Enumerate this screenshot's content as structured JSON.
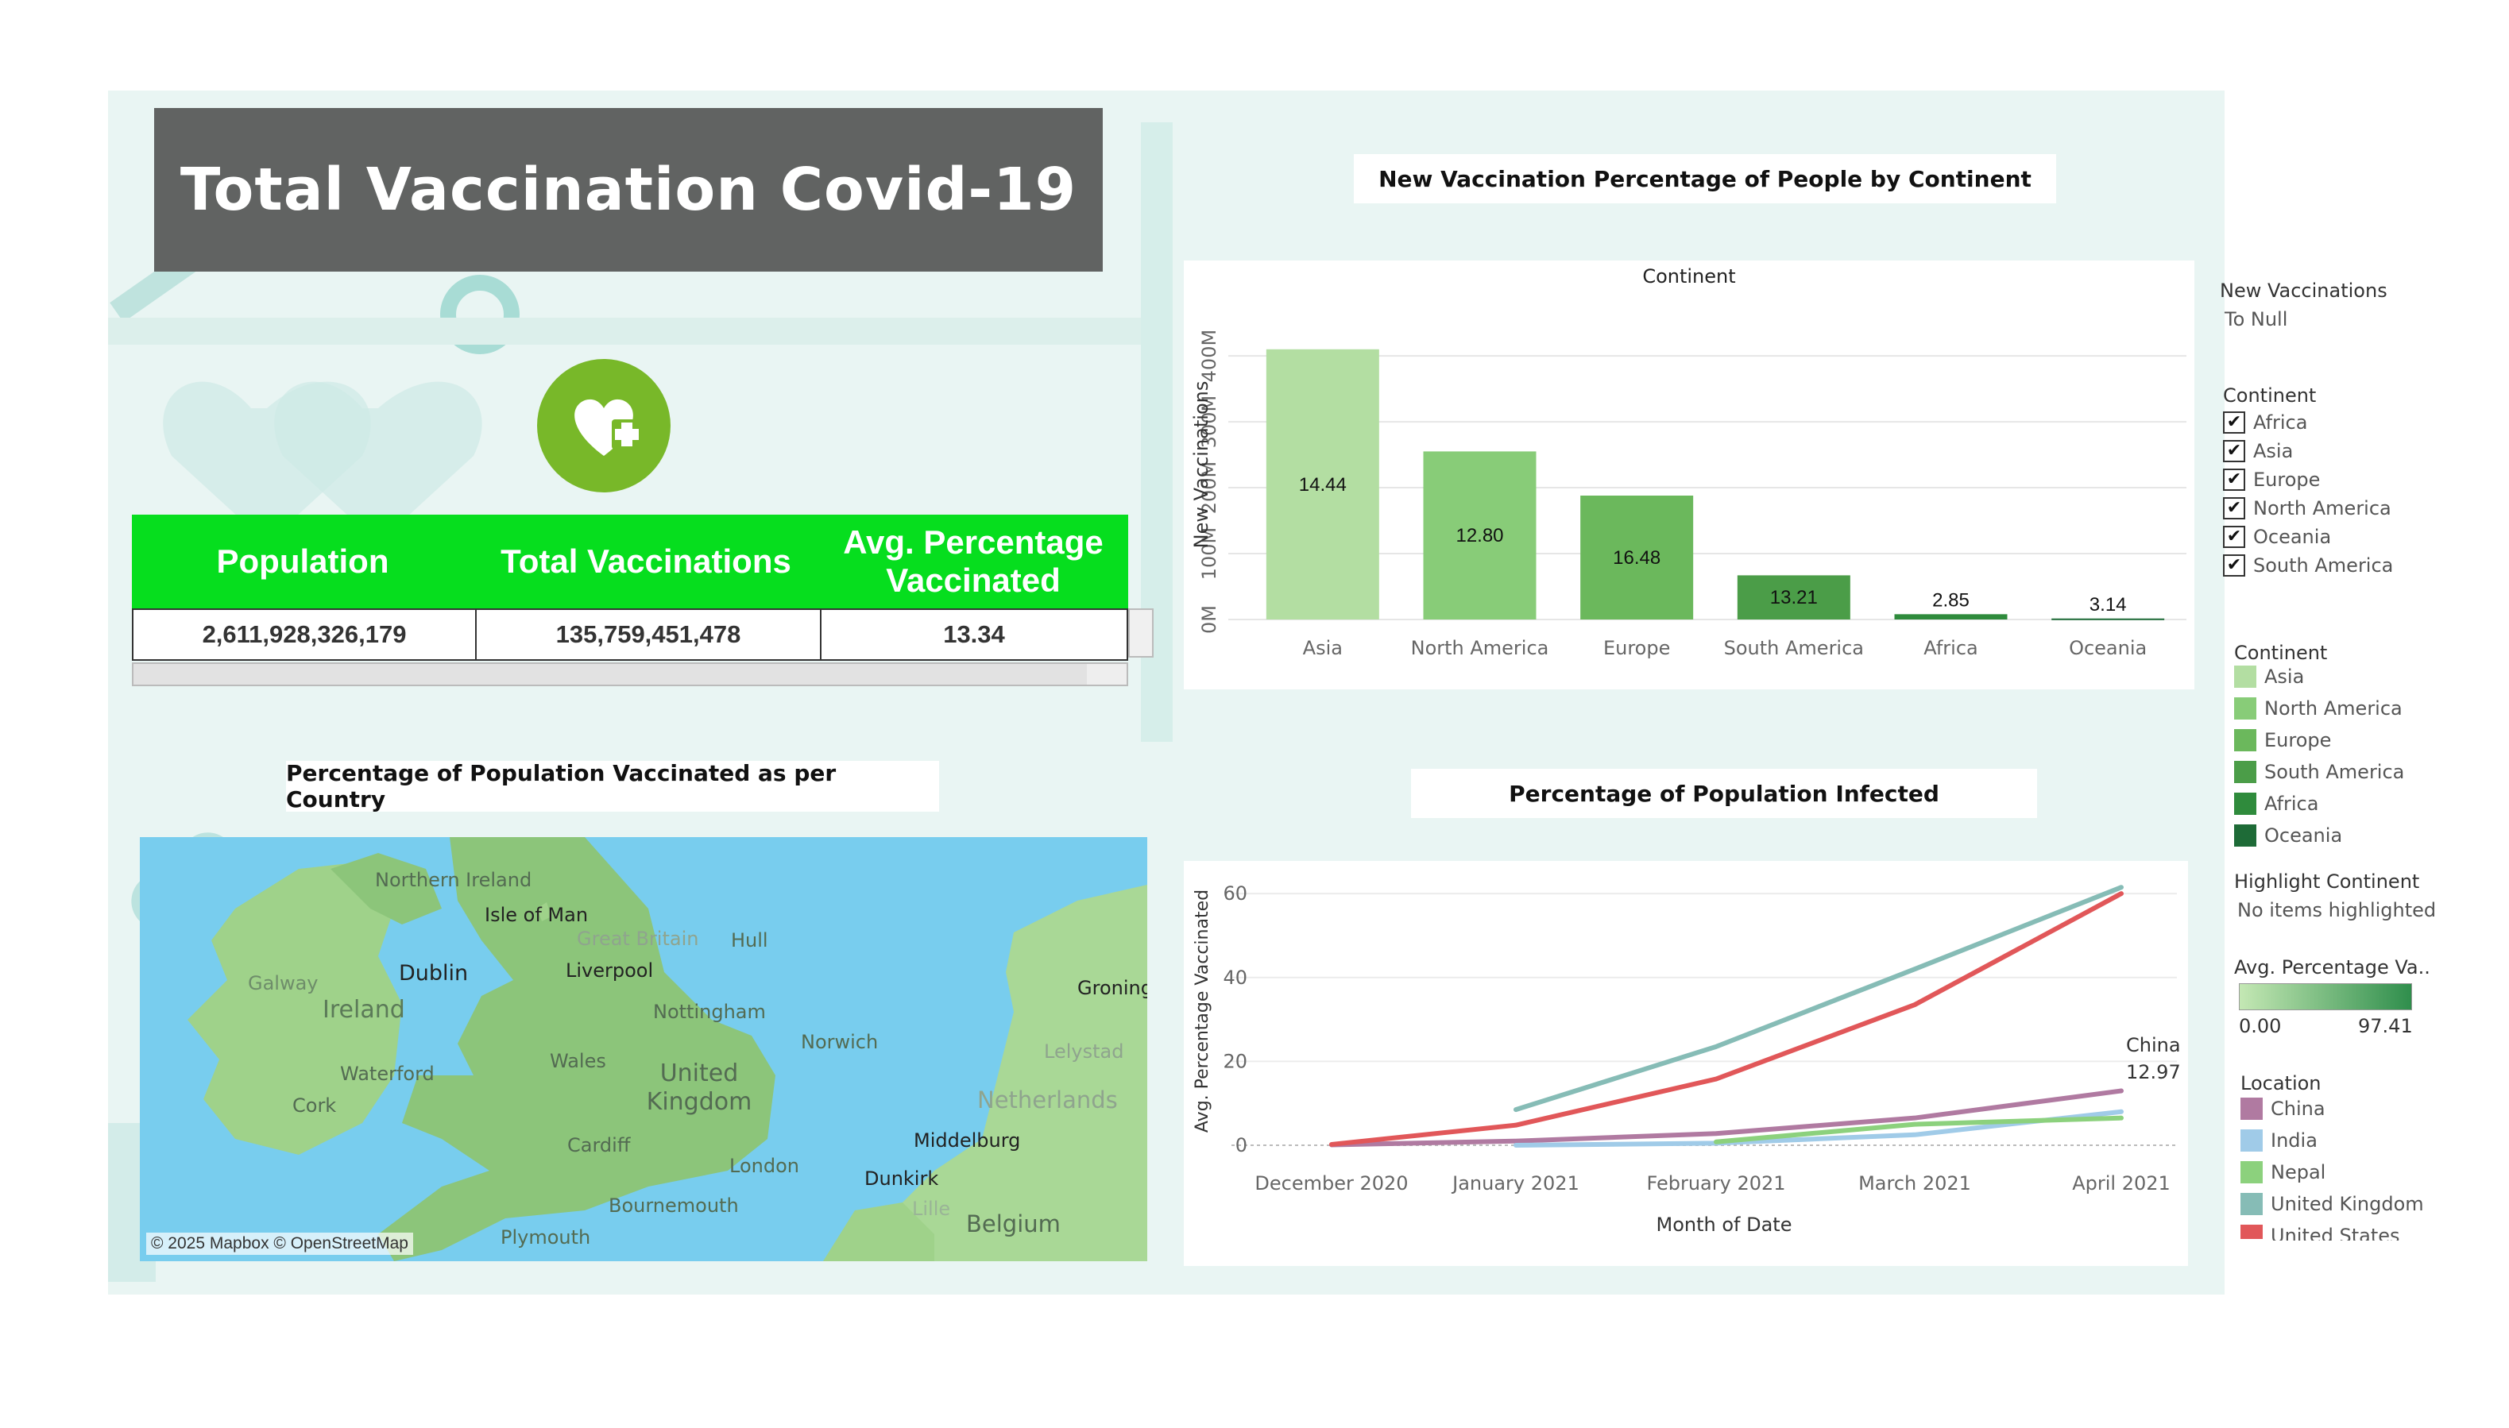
{
  "title": "Total Vaccination Covid-19",
  "kpi": {
    "headers": {
      "population": "Population",
      "total_vaccinations": "Total Vaccinations",
      "avg_pct_line1": "Avg. Percentage",
      "avg_pct_line2": "Vaccinated"
    },
    "values": {
      "population": "2,611,928,326,179",
      "total_vaccinations": "135,759,451,478",
      "avg_pct": "13.34"
    }
  },
  "map_panel": {
    "title": "Percentage of Population Vaccinated as per Country",
    "attribution": "© 2025 Mapbox © OpenStreetMap",
    "labels": [
      "Northern Ireland",
      "Isle of Man",
      "Great Britain",
      "Hull",
      "Galway",
      "Dublin",
      "Ireland",
      "Liverpool",
      "Nottingham",
      "Norwich",
      "Groning",
      "Wales",
      "United Kingdom",
      "Waterford",
      "Cork",
      "Cardiff",
      "London",
      "Middelburg",
      "Dunkirk",
      "Bournemouth",
      "Plymouth",
      "Lille",
      "Belgium",
      "Netherlands",
      "Lelystad"
    ]
  },
  "bar_panel": {
    "title": "New Vaccination Percentage of People by Continent",
    "chart_title": "Continent"
  },
  "line_panel": {
    "title": "Percentage of Population Infected",
    "annotation_name": "China",
    "annotation_value": "12.97"
  },
  "legend": {
    "new_vacc_title": "New Vaccinations",
    "new_vacc_value": "To Null",
    "filter_title": "Continent",
    "filter_items": [
      "Africa",
      "Asia",
      "Europe",
      "North America",
      "Oceania",
      "South America"
    ],
    "filter_check": "✔",
    "color_title": "Continent",
    "color_items": [
      {
        "label": "Asia",
        "color": "#b3dea2"
      },
      {
        "label": "North America",
        "color": "#88cc78"
      },
      {
        "label": "Europe",
        "color": "#6bb85c"
      },
      {
        "label": "South America",
        "color": "#4b9d48"
      },
      {
        "label": "Africa",
        "color": "#2f8b3c"
      },
      {
        "label": "Oceania",
        "color": "#1e6b37"
      }
    ],
    "highlight_title": "Highlight Continent",
    "highlight_value": "No items highlighted",
    "gradient_title": "Avg. Percentage Va..",
    "gradient_min": "0.00",
    "gradient_max": "97.41",
    "location_title": "Location",
    "location_items": [
      {
        "label": "China",
        "color": "#b07aa1"
      },
      {
        "label": "India",
        "color": "#a0cbe8"
      },
      {
        "label": "Nepal",
        "color": "#8cd17d"
      },
      {
        "label": "United Kingdom",
        "color": "#86bcb6"
      },
      {
        "label": "United States",
        "color": "#e15759"
      }
    ]
  },
  "chart_data": [
    {
      "type": "bar",
      "title": "Continent",
      "xlabel": "",
      "ylabel": "New Vaccinations",
      "categories": [
        "Asia",
        "North America",
        "Europe",
        "South America",
        "Africa",
        "Oceania"
      ],
      "values": [
        410000000,
        255000000,
        188000000,
        67000000,
        8000000,
        1500000
      ],
      "data_labels": [
        "14.44",
        "12.80",
        "16.48",
        "13.21",
        "2.85",
        "3.14"
      ],
      "colors": [
        "#b3dea2",
        "#88cc78",
        "#6bb85c",
        "#4b9d48",
        "#2f8b3c",
        "#1e6b37"
      ],
      "yticks": [
        "0M",
        "100M",
        "200M",
        "300M",
        "400M"
      ],
      "ylim": [
        0,
        470000000
      ],
      "grid": true
    },
    {
      "type": "line",
      "title": "",
      "xlabel": "Month of Date",
      "ylabel": "Avg. Percentage Vaccinated",
      "x": [
        "December 2020",
        "January 2021",
        "February 2021",
        "March 2021",
        "April 2021"
      ],
      "yticks": [
        "0",
        "20",
        "40",
        "60"
      ],
      "ylim": [
        0,
        64
      ],
      "grid": true,
      "series": [
        {
          "name": "China",
          "color": "#b07aa1",
          "values": [
            0.1,
            1.0,
            2.8,
            6.5,
            12.97
          ]
        },
        {
          "name": "India",
          "color": "#a0cbe8",
          "values": [
            null,
            0.0,
            0.5,
            2.5,
            8.0
          ]
        },
        {
          "name": "Nepal",
          "color": "#8cd17d",
          "values": [
            null,
            null,
            0.8,
            5.0,
            6.5
          ]
        },
        {
          "name": "United Kingdom",
          "color": "#86bcb6",
          "values": [
            null,
            8.5,
            23.5,
            42.0,
            61.5
          ]
        },
        {
          "name": "United States",
          "color": "#e15759",
          "values": [
            0.2,
            4.8,
            15.8,
            33.5,
            60.0
          ]
        }
      ]
    }
  ]
}
